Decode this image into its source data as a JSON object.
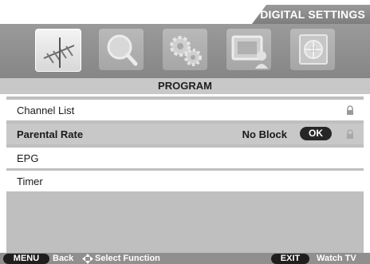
{
  "header": {
    "title": "DIGITAL SETTINGS"
  },
  "icons": [
    {
      "name": "antenna-icon",
      "active": true
    },
    {
      "name": "magnifier-icon",
      "active": false
    },
    {
      "name": "gears-icon",
      "active": false
    },
    {
      "name": "monitor-person-icon",
      "active": false
    },
    {
      "name": "film-reel-icon",
      "active": false
    }
  ],
  "section": {
    "title": "PROGRAM"
  },
  "menu": {
    "items": [
      {
        "label": "Channel List",
        "value": "",
        "locked": true
      },
      {
        "label": "Parental Rate",
        "value": "No Block",
        "ok": "OK",
        "locked": true,
        "selected": true
      },
      {
        "label": "EPG",
        "value": ""
      },
      {
        "label": "Timer",
        "value": ""
      }
    ]
  },
  "footer": {
    "menu_key": "MENU",
    "back": "Back",
    "select": "Select Function",
    "exit_key": "EXIT",
    "watch": "Watch TV"
  },
  "colors": {
    "accent_gray": "#8f8f8f",
    "selected_row": "#c8c8c8",
    "panel": "#bfbfbf"
  }
}
